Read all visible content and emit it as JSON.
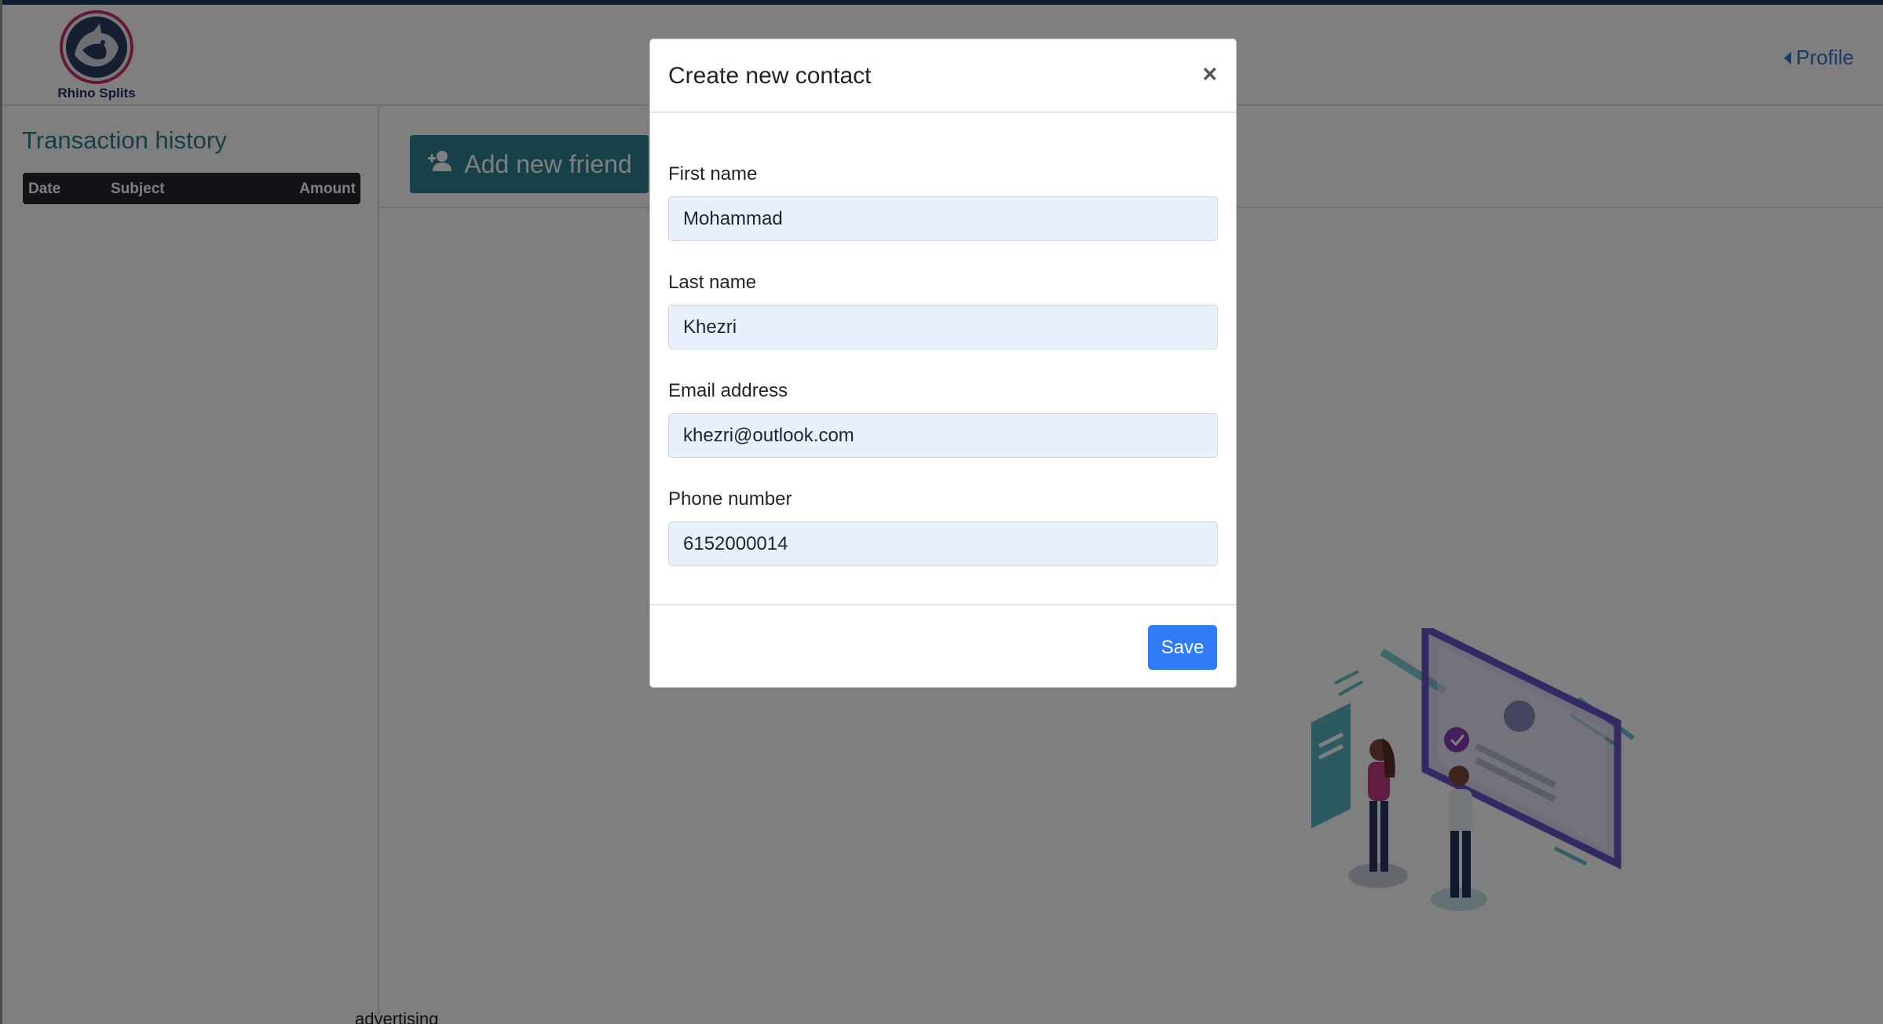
{
  "brand": {
    "name": "Rhino Splits"
  },
  "header": {
    "profile_label": "Profile"
  },
  "sidebar": {
    "title": "Transaction history",
    "columns": {
      "date": "Date",
      "subject": "Subject",
      "amount": "Amount"
    }
  },
  "main": {
    "add_friend_label": "Add new friend"
  },
  "bottom": {
    "partial_text": "advertising"
  },
  "modal": {
    "title": "Create new contact",
    "close_glyph": "×",
    "fields": {
      "first_name": {
        "label": "First name",
        "value": "Mohammad"
      },
      "last_name": {
        "label": "Last name",
        "value": "Khezri"
      },
      "email": {
        "label": "Email address",
        "value": "khezri@outlook.com"
      },
      "phone": {
        "label": "Phone number",
        "value": "6152000014"
      }
    },
    "save_label": "Save"
  },
  "colors": {
    "accent_teal": "#2e8091",
    "title_teal": "#2c7c91",
    "link_blue": "#2f73c9",
    "primary_blue": "#2f7cf6",
    "topbar_navy": "#1e3a66",
    "autofill_bg": "#e8f0fe"
  },
  "icons": {
    "logo": "rhino-logo-icon",
    "profile_caret": "caret-left-icon",
    "add_friend": "user-plus-icon",
    "close": "close-icon"
  }
}
